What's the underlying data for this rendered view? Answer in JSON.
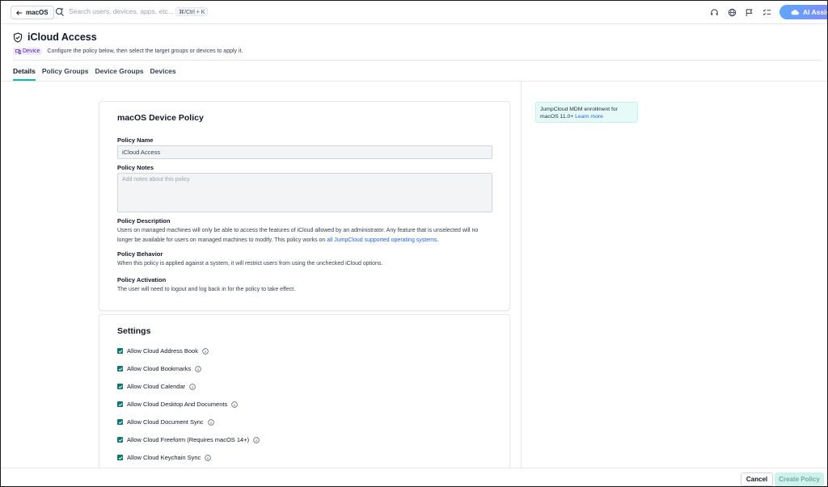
{
  "topbar": {
    "back_label": "macOS",
    "search_placeholder": "Search users, devices, apps, etc...",
    "search_shortcut": "⌘/Ctrl + K",
    "ai_label": "AI Assist"
  },
  "header": {
    "title": "iCloud Access",
    "badge": "Device",
    "subtitle": "Configure the policy below, then select the target groups or devices to apply it."
  },
  "tabs": [
    {
      "label": "Details",
      "active": true
    },
    {
      "label": "Policy Groups",
      "active": false
    },
    {
      "label": "Device Groups",
      "active": false
    },
    {
      "label": "Devices",
      "active": false
    }
  ],
  "policy_card": {
    "title": "macOS Device Policy",
    "name_label": "Policy Name",
    "name_value": "iCloud Access",
    "notes_label": "Policy Notes",
    "notes_placeholder": "Add notes about this policy",
    "description_label": "Policy Description",
    "description_text": "Users on managed machines will only be able to access the features of iCloud allowed by an administrator. Any feature that is unselected will no longer be available for users on managed machines to modify. This policy works on ",
    "description_link": "all JumpCloud supported operating systems",
    "description_end": ".",
    "behavior_label": "Policy Behavior",
    "behavior_text": "When this policy is applied against a system, it will restrict users from using the unchecked iCloud options.",
    "activation_label": "Policy Activation",
    "activation_text": "The user will need to logout and log back in for the policy to take effect."
  },
  "settings_card": {
    "title": "Settings",
    "options": [
      {
        "label": "Allow Cloud Address Book",
        "checked": true
      },
      {
        "label": "Allow Cloud Bookmarks",
        "checked": true
      },
      {
        "label": "Allow Cloud Calendar",
        "checked": true
      },
      {
        "label": "Allow Cloud Desktop And Documents",
        "checked": true
      },
      {
        "label": "Allow Cloud Document Sync",
        "checked": true
      },
      {
        "label": "Allow Cloud Freeform (Requires macOS 14+)",
        "checked": true
      },
      {
        "label": "Allow Cloud Keychain Sync",
        "checked": true
      }
    ]
  },
  "side_info": {
    "text": "JumpCloud MDM enrollment for macOS 11.0+ ",
    "link": "Learn more"
  },
  "footer": {
    "cancel_label": "Cancel",
    "create_label": "Create Policy"
  },
  "colors": {
    "accent": "#14b8a6",
    "checkbox": "#0f766e",
    "link": "#2563eb",
    "badge_bg": "#ede9fe"
  }
}
